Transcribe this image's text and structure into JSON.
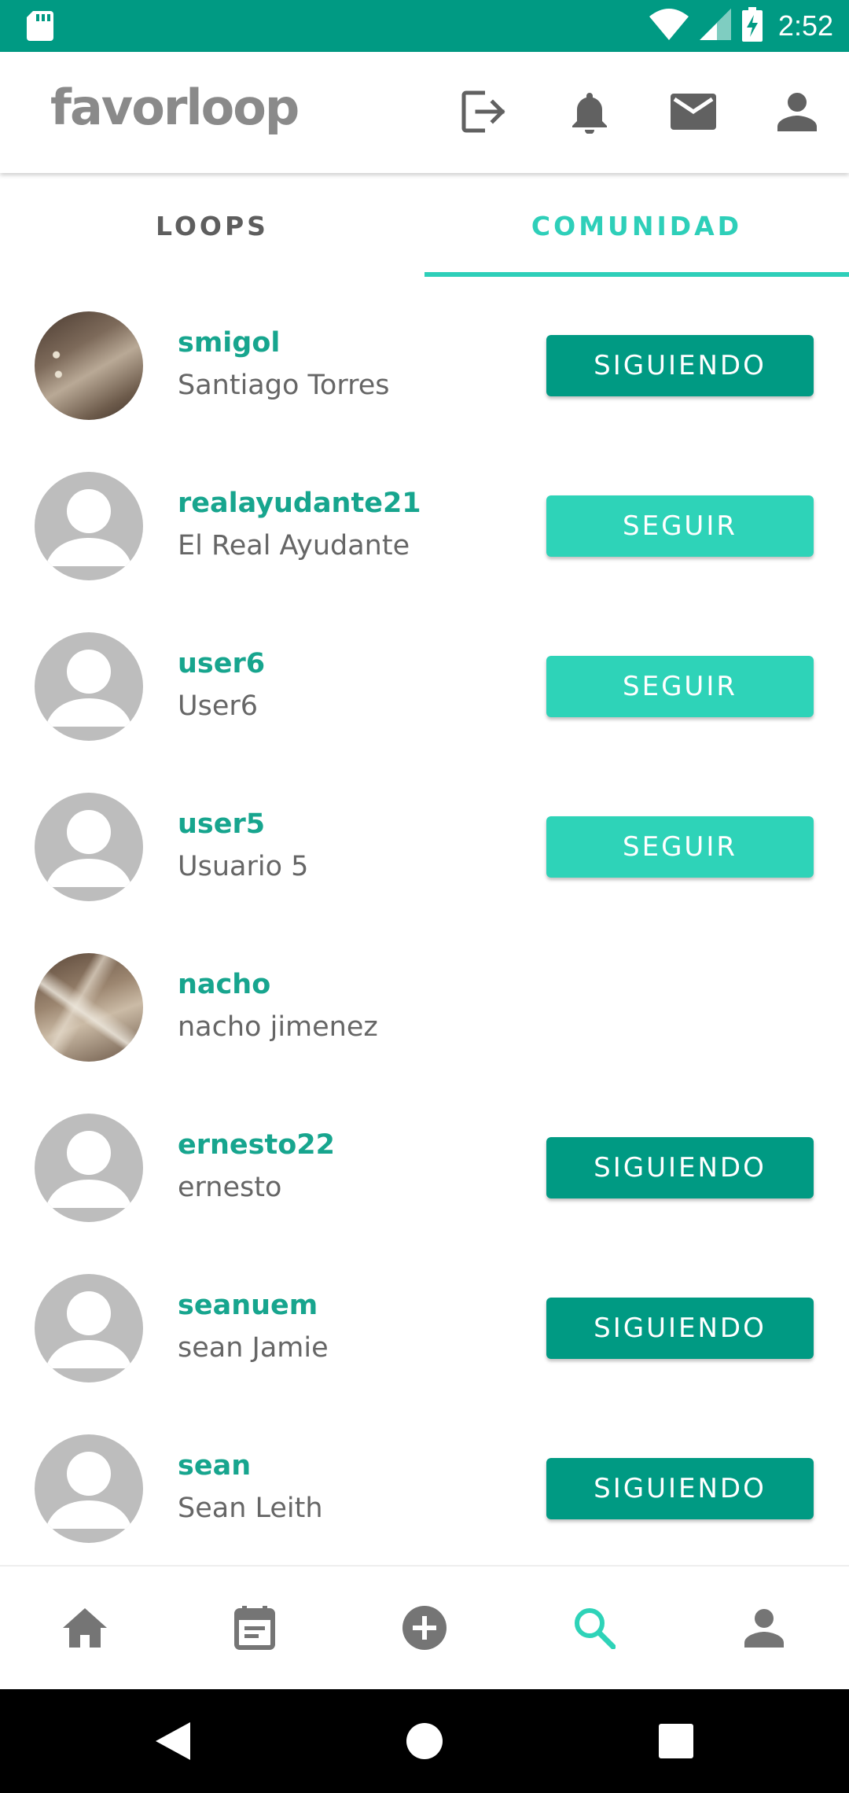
{
  "status_bar": {
    "time": "2:52",
    "background": "#009a83",
    "icons": [
      "sd-card-icon",
      "wifi-icon",
      "signal-icon",
      "battery-charging-icon"
    ]
  },
  "app_bar": {
    "logo_text": "favorloop",
    "icons": [
      "logout-icon",
      "bell-icon",
      "mail-icon",
      "person-icon"
    ]
  },
  "tabs": [
    {
      "label": "LOOPS",
      "selected": false
    },
    {
      "label": "COMUNIDAD",
      "selected": true
    }
  ],
  "colors": {
    "primary_dark": "#009a83",
    "accent": "#2ed3b8",
    "username": "#17a58e",
    "fullname": "#666666"
  },
  "users": [
    {
      "username": "smigol",
      "fullname": "Santiago Torres",
      "button": "SIGUIENDO",
      "avatar": "photo"
    },
    {
      "username": "realayudante21",
      "fullname": "El Real Ayudante",
      "button": "SEGUIR",
      "avatar": "default"
    },
    {
      "username": "user6",
      "fullname": "User6",
      "button": "SEGUIR",
      "avatar": "default"
    },
    {
      "username": "user5",
      "fullname": "Usuario 5",
      "button": "SEGUIR",
      "avatar": "default"
    },
    {
      "username": "nacho",
      "fullname": "nacho jimenez",
      "button": "",
      "avatar": "photo"
    },
    {
      "username": "ernesto22",
      "fullname": "ernesto",
      "button": "SIGUIENDO",
      "avatar": "default"
    },
    {
      "username": "seanuem",
      "fullname": "sean Jamie",
      "button": "SIGUIENDO",
      "avatar": "default"
    },
    {
      "username": "sean",
      "fullname": "Sean Leith",
      "button": "SIGUIENDO",
      "avatar": "default"
    }
  ],
  "bottom_nav": {
    "items": [
      "home-icon",
      "calendar-icon",
      "add-circle-icon",
      "search-icon",
      "person-icon"
    ],
    "active": "search-icon"
  },
  "system_nav": [
    "back-icon",
    "home-circle-icon",
    "recents-icon"
  ]
}
